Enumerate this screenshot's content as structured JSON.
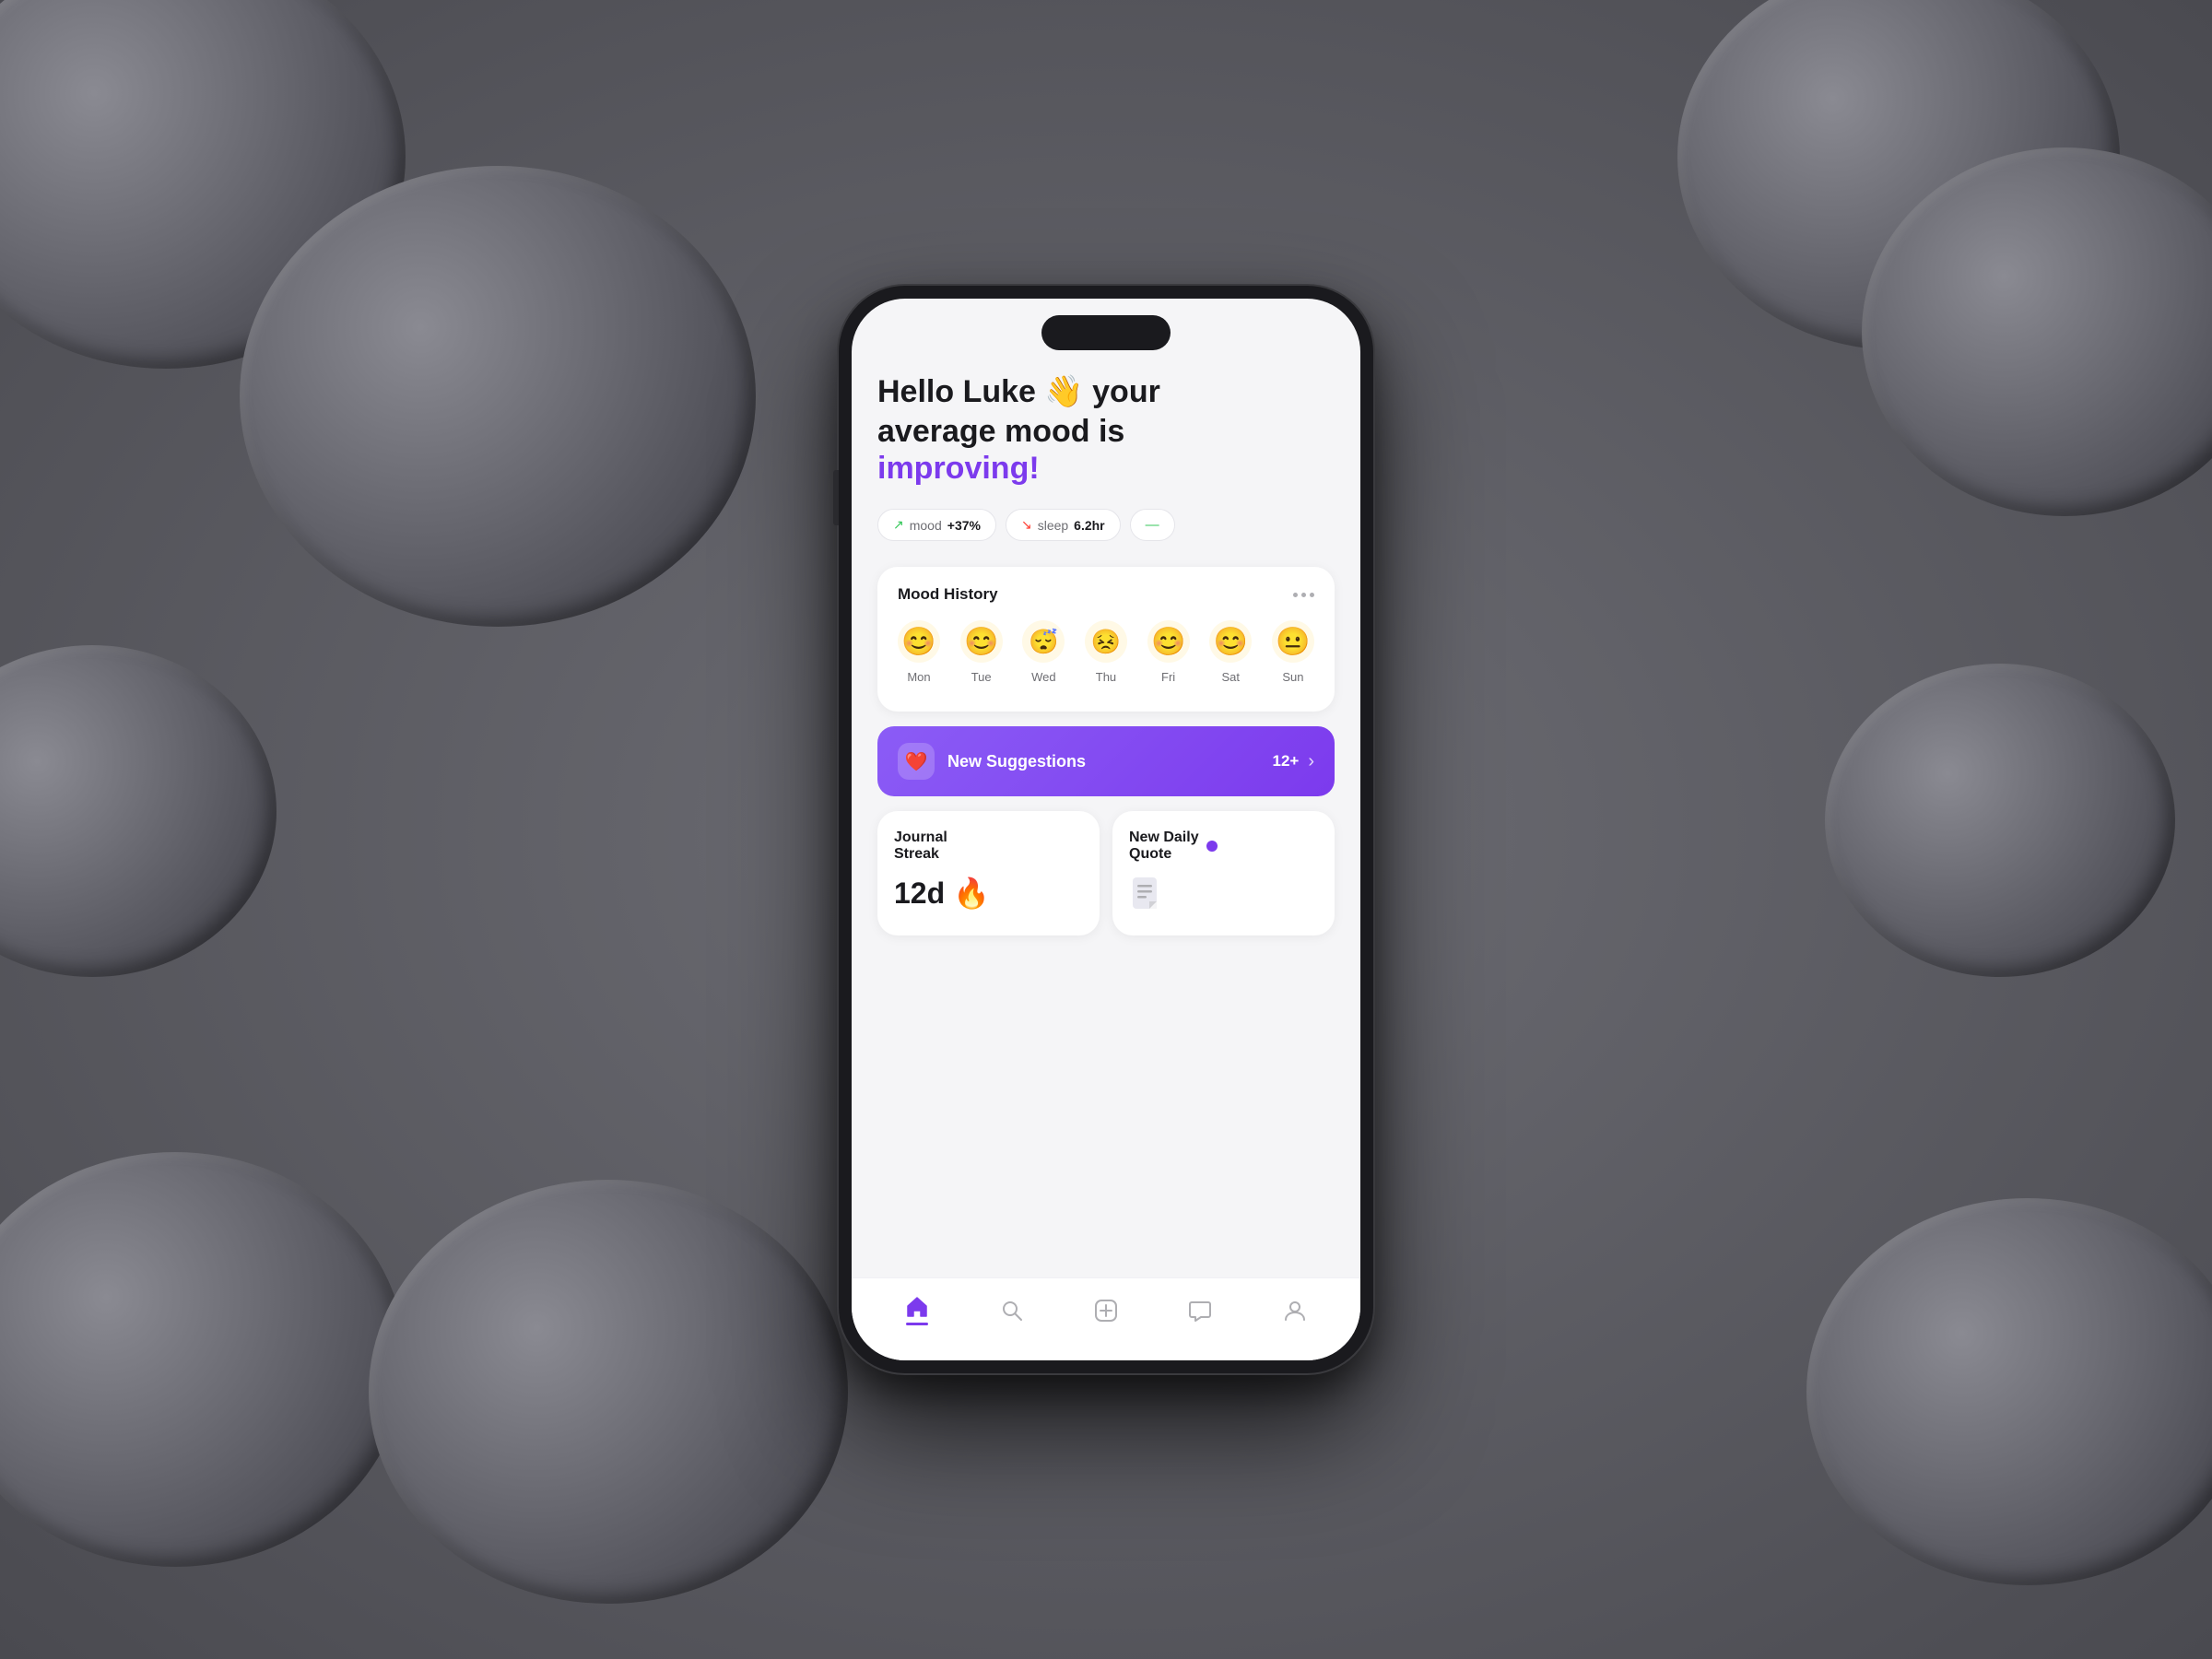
{
  "background": {
    "color": "#5a5a5f"
  },
  "greeting": {
    "line1": "Hello Luke 👋 your",
    "line2": "average mood is",
    "improving": "improving!"
  },
  "stats": [
    {
      "icon": "trend-up",
      "label": "mood",
      "value": "+37%"
    },
    {
      "icon": "trend-down",
      "label": "sleep",
      "value": "6.2hr"
    }
  ],
  "mood_history": {
    "title": "Mood History",
    "days": [
      {
        "day": "Mon",
        "emoji": "😊"
      },
      {
        "day": "Tue",
        "emoji": "😊"
      },
      {
        "day": "Wed",
        "emoji": "😴"
      },
      {
        "day": "Thu",
        "emoji": "😣"
      },
      {
        "day": "Fri",
        "emoji": "😊"
      },
      {
        "day": "Sat",
        "emoji": "😊"
      },
      {
        "day": "Sun",
        "emoji": "😐"
      }
    ]
  },
  "suggestions": {
    "label": "New Suggestions",
    "count": "12+",
    "heart": "❤️"
  },
  "journal_streak": {
    "title": "Journal Streak",
    "value": "12d",
    "fire": "🔥"
  },
  "daily_quote": {
    "title": "New Daily Quote",
    "dot_color": "#7c3aed"
  },
  "nav": {
    "items": [
      {
        "name": "home",
        "label": "home",
        "active": true
      },
      {
        "name": "search",
        "label": "search",
        "active": false
      },
      {
        "name": "add",
        "label": "add",
        "active": false
      },
      {
        "name": "chat",
        "label": "chat",
        "active": false
      },
      {
        "name": "profile",
        "label": "profile",
        "active": false
      }
    ]
  }
}
